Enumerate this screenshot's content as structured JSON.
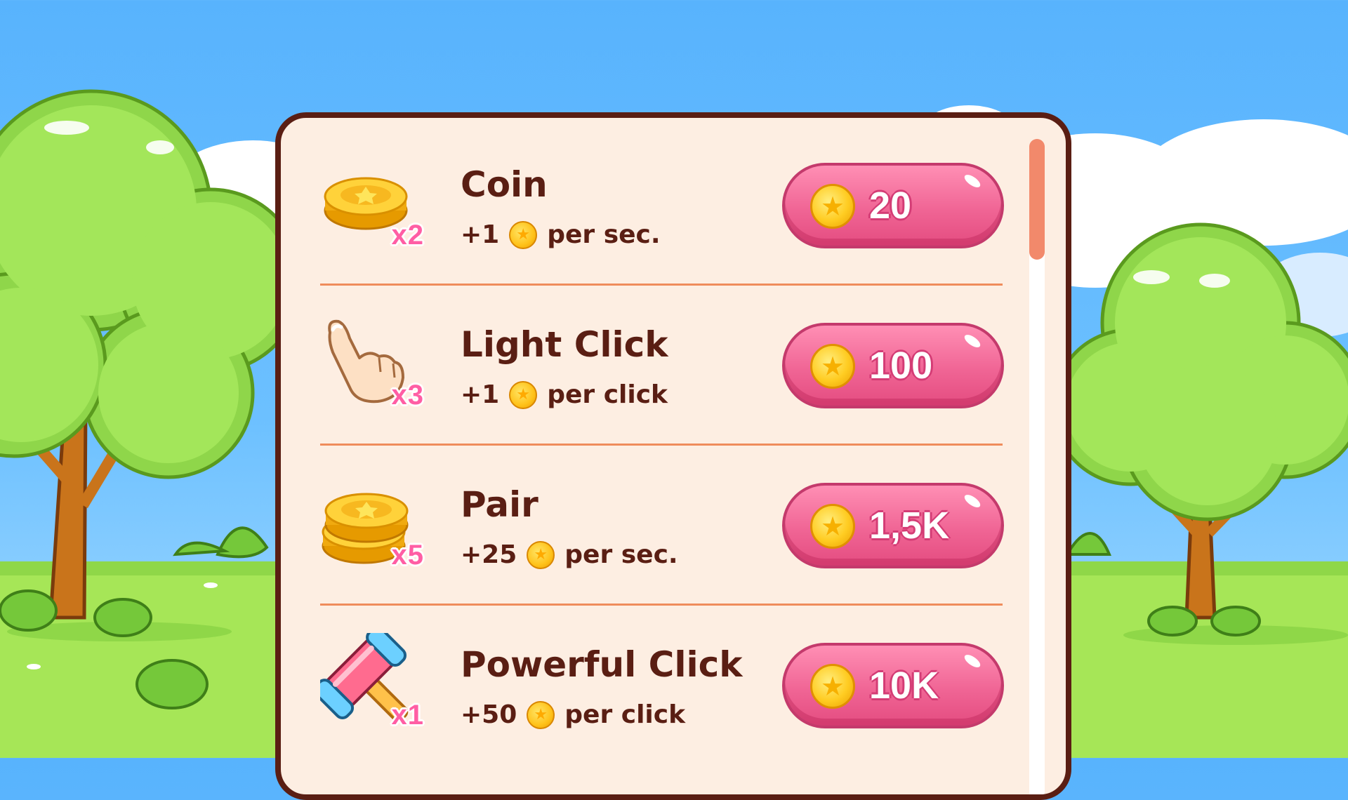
{
  "shop": {
    "items": [
      {
        "icon": "coin-stack-icon",
        "multiplier": "x2",
        "name": "Coin",
        "bonus": "+1",
        "rate": "per sec.",
        "price": "20"
      },
      {
        "icon": "pointing-hand-icon",
        "multiplier": "x3",
        "name": "Light Click",
        "bonus": "+1",
        "rate": "per click",
        "price": "100"
      },
      {
        "icon": "coin-pair-icon",
        "multiplier": "x5",
        "name": "Pair",
        "bonus": "+25",
        "rate": "per sec.",
        "price": "1,5K"
      },
      {
        "icon": "hammer-icon",
        "multiplier": "x1",
        "name": "Powerful Click",
        "bonus": "+50",
        "rate": "per click",
        "price": "10K"
      }
    ],
    "scroll_position": 0
  },
  "colors": {
    "panel_bg": "#fdeee2",
    "panel_border": "#5a1e13",
    "text": "#5a1e13",
    "button": "#f06595",
    "divider": "#ef8c5b",
    "scroll_thumb": "#f2896b"
  }
}
